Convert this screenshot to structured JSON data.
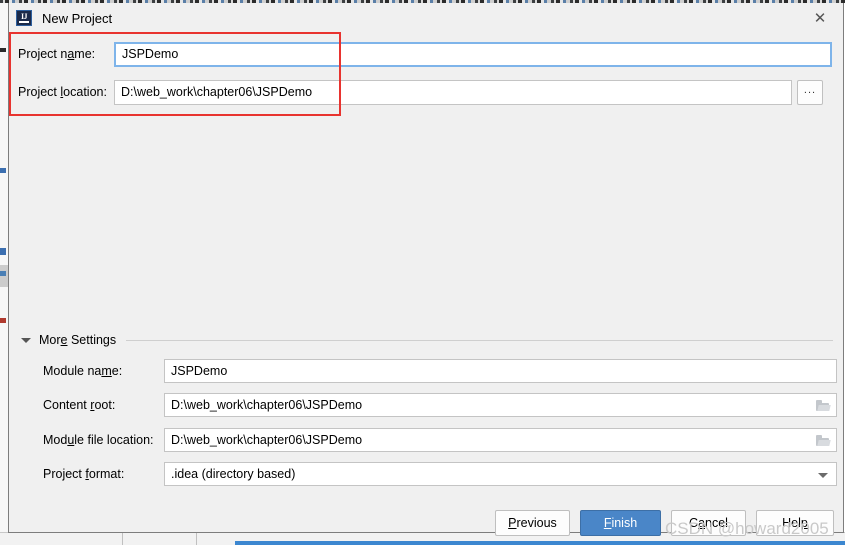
{
  "window": {
    "title": "New Project",
    "app_icon": "intellij-idea-icon",
    "icon_text": "IJ",
    "close_label": "✕"
  },
  "top_form": {
    "project_name": {
      "label_before": "Project n",
      "label_mnemonic": "a",
      "label_after": "me:",
      "value": "JSPDemo",
      "placeholder": ""
    },
    "project_location": {
      "label_before": "Project ",
      "label_mnemonic": "l",
      "label_after": "ocation:",
      "value": "D:\\web_work\\chapter06\\JSPDemo",
      "placeholder": ""
    },
    "browse_button_label": "..."
  },
  "more_settings": {
    "label_before": "Mor",
    "label_mnemonic": "e",
    "label_after": " Settings",
    "expanded": true,
    "rows": [
      {
        "label_before": "Module na",
        "label_mnemonic": "m",
        "label_after": "e:",
        "value": "JSPDemo",
        "trailing_icon": "none"
      },
      {
        "label_before": "Content ",
        "label_mnemonic": "r",
        "label_after": "oot:",
        "value": "D:\\web_work\\chapter06\\JSPDemo",
        "trailing_icon": "folder-icon"
      },
      {
        "label_before": "Mod",
        "label_mnemonic": "u",
        "label_after": "le file location:",
        "value": "D:\\web_work\\chapter06\\JSPDemo",
        "trailing_icon": "folder-icon"
      },
      {
        "label_before": "Project ",
        "label_mnemonic": "f",
        "label_after": "ormat:",
        "value": ".idea (directory based)",
        "trailing_icon": "chevron-down-icon"
      }
    ]
  },
  "buttons": {
    "previous": {
      "before": "",
      "mnemonic": "P",
      "after": "revious"
    },
    "finish": {
      "before": "",
      "mnemonic": "F",
      "after": "inish"
    },
    "cancel": {
      "before": "C",
      "mnemonic": "a",
      "after": "ncel"
    },
    "help": {
      "before": "Hel",
      "mnemonic": "p",
      "after": ""
    }
  },
  "annotation": {
    "color": "#e8332f",
    "type": "red-rectangle-highlight"
  },
  "watermark": {
    "text": "CSDN @howard2005"
  },
  "colors": {
    "dialog_bg": "#f0f0f0",
    "field_bg": "#ffffff",
    "focus_border": "#7eb4ea",
    "primary_button": "#4a86c8",
    "annotation_red": "#e8332f"
  }
}
